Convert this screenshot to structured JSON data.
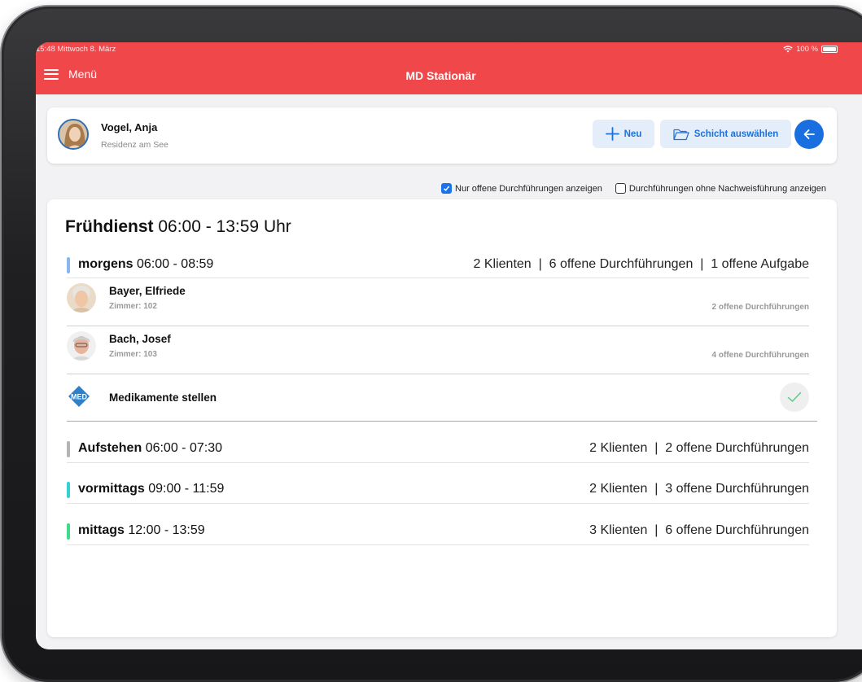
{
  "status": {
    "time_date": "15:48  Mittwoch 8. März",
    "battery": "100 %"
  },
  "header": {
    "menu_label": "Menü",
    "title": "MD Stationär"
  },
  "user": {
    "name": "Vogel, Anja",
    "facility": "Residenz am See"
  },
  "actions": {
    "new_label": "Neu",
    "select_shift_label": "Schicht auswählen"
  },
  "filters": {
    "only_open": {
      "label": "Nur offene Durchführungen anzeigen",
      "checked": true
    },
    "without_proof": {
      "label": "Durchführungen ohne Nachweisführung anzeigen",
      "checked": false
    }
  },
  "shift": {
    "name": "Frühdienst",
    "time": "06:00 - 13:59 Uhr"
  },
  "sections": [
    {
      "name": "morgens",
      "time": "06:00 - 08:59",
      "summary": "2 Klienten  |  6 offene Durchführungen  |  1 offene Aufgabe",
      "color": "#8ab6ef"
    },
    {
      "name": "Aufstehen",
      "time": "06:00 - 07:30",
      "summary": "2 Klienten  |  2 offene Durchführungen",
      "color": "#b4b4b4"
    },
    {
      "name": "vormittags",
      "time": "09:00 - 11:59",
      "summary": "2 Klienten  |  3 offene Durchführungen",
      "color": "#35cfd6"
    },
    {
      "name": "mittags",
      "time": "12:00 - 13:59",
      "summary": "3 Klienten  |  6 offene Durchführungen",
      "color": "#43d98a"
    }
  ],
  "clients": [
    {
      "name": "Bayer, Elfriede",
      "room": "Zimmer: 102",
      "open": "2 offene Durchführungen"
    },
    {
      "name": "Bach, Josef",
      "room": "Zimmer: 103",
      "open": "4 offene Durchführungen"
    }
  ],
  "task": {
    "badge": "MED",
    "label": "Medikamente stellen",
    "done": true
  }
}
